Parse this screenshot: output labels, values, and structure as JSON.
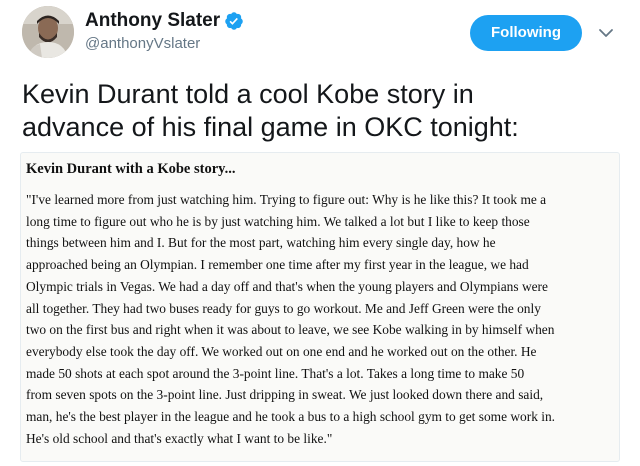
{
  "user": {
    "display_name": "Anthony Slater",
    "handle": "@anthonyVslater",
    "verified": true,
    "avatar_icon": "avatar-photo"
  },
  "actions": {
    "follow_label": "Following",
    "menu_icon": "chevron-down-icon"
  },
  "tweet": {
    "text_lines": [
      "Kevin Durant told a cool Kobe story in",
      "advance of his final game in OKC tonight:"
    ]
  },
  "media": {
    "heading": "Kevin Durant with a Kobe story...",
    "lines": [
      "\"I've learned more from just watching him. Trying to figure out: Why is he like this? It took me a",
      "long time to figure out who he is by just watching him. We talked a lot but I like to keep those",
      "things between him and I. But for the most part, watching him every single day, how he",
      "approached being an Olympian. I remember one time after my first year in the league, we had",
      "Olympic trials in Vegas. We had a day off and that's when the young players and Olympians were",
      "all together. They had two buses ready for guys to go workout. Me and Jeff Green were the only",
      "two on the first bus and right when it was about to leave, we see Kobe walking in by himself when",
      "everybody else took the day off. We worked out on one end and he worked out on the other. He",
      "made 50 shots at each spot around the 3-point line. That's a lot. Takes a long time to make 50",
      "from seven spots on the 3-point line. Just dripping in sweat. We just looked down there and said,",
      "man, he's the best player in the league and he took a bus to a high school gym to get some work in.",
      "He's old school and that's exactly what I want to be like.\""
    ]
  },
  "colors": {
    "follow_button": "#1da1f2",
    "verified_badge": "#1da1f2",
    "handle_text": "#657786"
  }
}
